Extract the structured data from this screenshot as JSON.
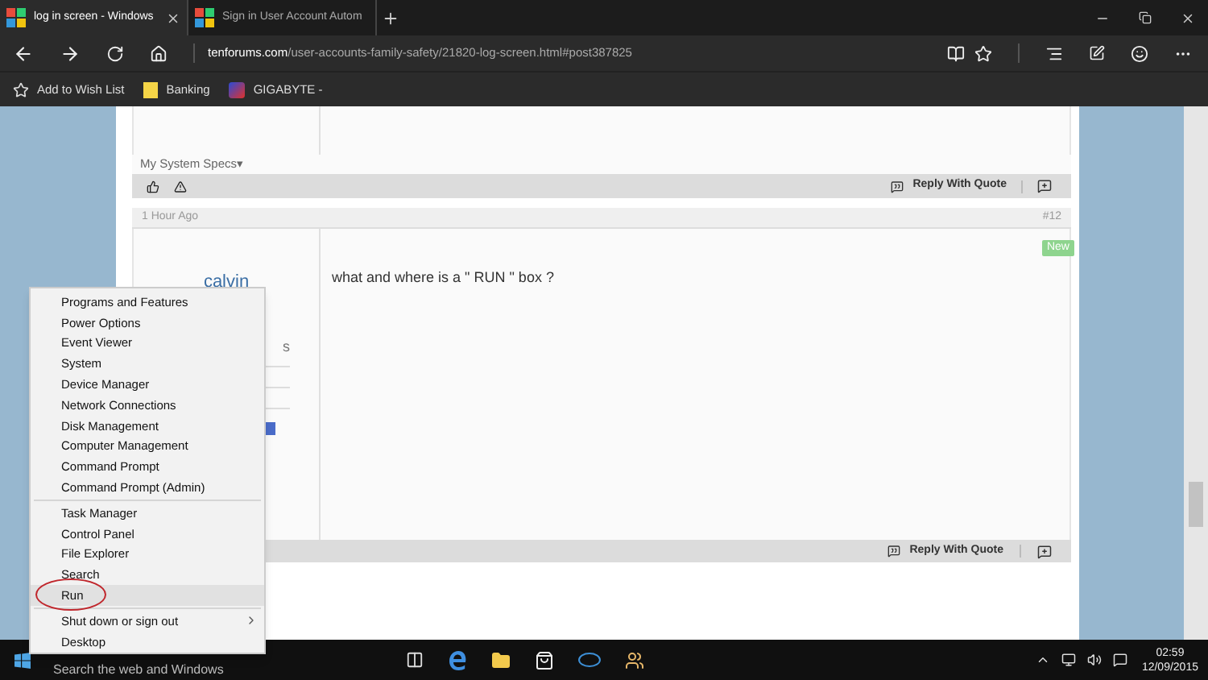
{
  "browser": {
    "tabs": [
      {
        "title": "log in screen - Windows",
        "selected": true
      },
      {
        "title": "Sign in User Account Autom",
        "selected": false
      }
    ],
    "url_host": "tenforums.com",
    "url_path": "/user-accounts-family-safety/21820-log-screen.html#post387825",
    "favorites": [
      {
        "kind": "star",
        "label": "Add to Wish List"
      },
      {
        "kind": "folder",
        "label": "Banking"
      },
      {
        "kind": "site",
        "label": "GIGABYTE -"
      }
    ]
  },
  "page": {
    "system_specs": "My System Specs",
    "system_specs_caret": "▾",
    "reply_label": "Reply With Quote",
    "post": {
      "time": "1 Hour Ago",
      "number": "#12",
      "author": "calvin",
      "author_fragment": "s",
      "message": "what and where is a \" RUN \" box ?",
      "badge": "New"
    },
    "bottom_reply_label": "Reply With Quote"
  },
  "context_menu": {
    "groups": [
      [
        {
          "label": "Programs and Features",
          "selected": false,
          "kind": "item"
        },
        {
          "label": "Power Options",
          "selected": false,
          "kind": "item"
        },
        {
          "label": "Event Viewer",
          "selected": false,
          "kind": "item"
        },
        {
          "label": "System",
          "selected": false,
          "kind": "item"
        },
        {
          "label": "Device Manager",
          "selected": false,
          "kind": "item"
        },
        {
          "label": "Network Connections",
          "selected": false,
          "kind": "item"
        },
        {
          "label": "Disk Management",
          "selected": false,
          "kind": "item"
        },
        {
          "label": "Computer Management",
          "selected": false,
          "kind": "item"
        },
        {
          "label": "Command Prompt",
          "selected": false,
          "kind": "item"
        },
        {
          "label": "Command Prompt (Admin)",
          "selected": false,
          "kind": "item"
        }
      ],
      [
        {
          "label": "Task Manager",
          "selected": false,
          "kind": "item"
        },
        {
          "label": "Control Panel",
          "selected": false,
          "kind": "item"
        },
        {
          "label": "File Explorer",
          "selected": false,
          "kind": "item"
        },
        {
          "label": "Search",
          "selected": false,
          "kind": "item"
        },
        {
          "label": "Run",
          "selected": true,
          "kind": "item"
        }
      ],
      [
        {
          "label": "Shut down or sign out",
          "selected": false,
          "kind": "submenu"
        },
        {
          "label": "Desktop",
          "selected": false,
          "kind": "item"
        }
      ]
    ]
  },
  "taskbar": {
    "search_placeholder": "Search the web and Windows",
    "time": "02:59",
    "date": "12/09/2015"
  }
}
